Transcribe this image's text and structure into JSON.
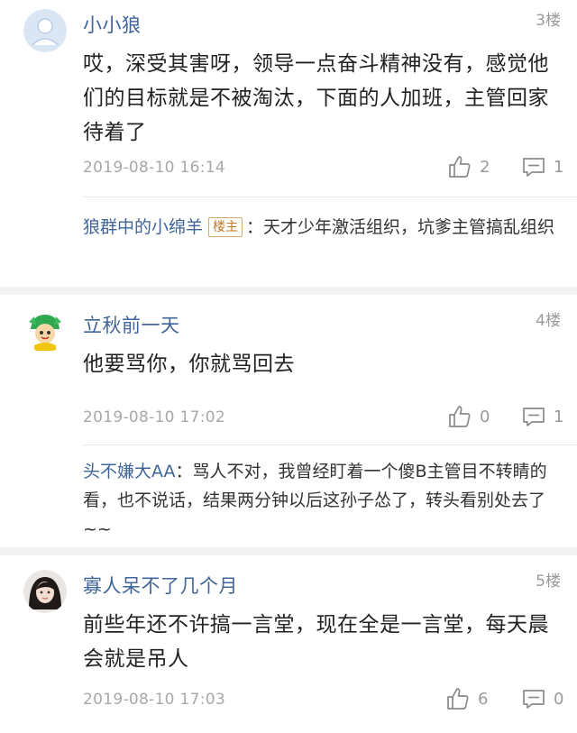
{
  "comments": [
    {
      "username": "小小狼",
      "floor": "3楼",
      "content": "哎，深受其害呀，领导一点奋斗精神没有，感觉他们的目标就是不被淘汰，下面的人加班，主管回家待着了",
      "time": "2019-08-10 16:14",
      "likes": "2",
      "replies": "1",
      "reply": {
        "name": "狼群中的小绵羊",
        "badge": "楼主",
        "text": "：天才少年激活组织，坑爹主管搞乱组织"
      }
    },
    {
      "username": "立秋前一天",
      "floor": "4楼",
      "content": "他要骂你，你就骂回去",
      "time": "2019-08-10 17:02",
      "likes": "0",
      "replies": "1",
      "reply": {
        "name": "头不嫌大AA",
        "text": "：骂人不对，我曾经盯着一个傻B主管目不转睛的看，也不说话，结果两分钟以后这孙子怂了，转头看别处去了~~"
      }
    },
    {
      "username": "寡人呆不了几个月",
      "floor": "5楼",
      "content": "前些年还不许搞一言堂，现在全是一言堂，每天晨会就是吊人",
      "time": "2019-08-10 17:03",
      "likes": "6",
      "replies": "0"
    }
  ],
  "icons": {
    "like": "thumbs-up-icon",
    "comment": "comment-bubble-icon"
  },
  "colors": {
    "username": "#406599",
    "meta": "#a8a8a8",
    "separator": "#f2f2f2"
  }
}
